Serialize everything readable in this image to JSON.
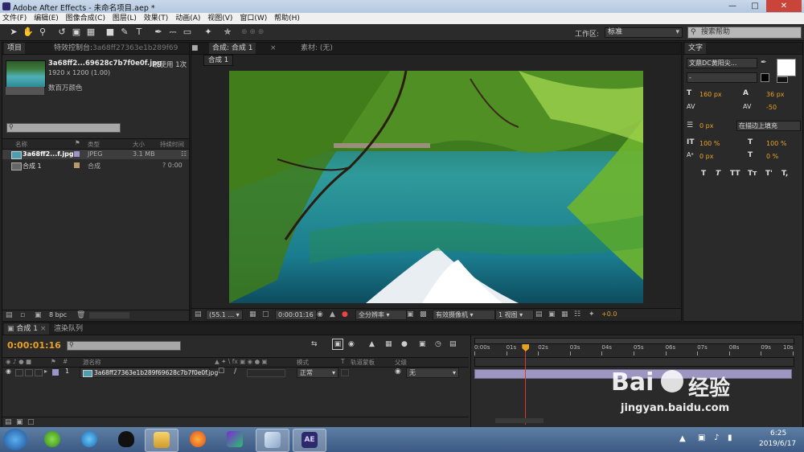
{
  "window": {
    "title": "Adobe After Effects - 未命名项目.aep *"
  },
  "menu": [
    "文件(F)",
    "编辑(E)",
    "图像合成(C)",
    "图层(L)",
    "效果(T)",
    "动画(A)",
    "视图(V)",
    "窗口(W)",
    "帮助(H)"
  ],
  "toolbar": {
    "workspace_label": "工作区:",
    "workspace_value": "标准",
    "search_placeholder": "搜索帮助"
  },
  "project": {
    "tab_project": "项目",
    "tab_effects": "特效控制台:",
    "tab_effects_file": "3a68ff27363e1b289f69",
    "file_name": "3a68ff2...69628c7b7f0e0f.jpg",
    "used_count": "被使用 1次",
    "dims": "1920 x 1200 (1.00)",
    "color_info": "数百万颜色",
    "headers": {
      "name": "名称",
      "type": "类型",
      "size": "大小",
      "duration": "持续时间"
    },
    "items": [
      {
        "name": "3a68ff2...f.jpg",
        "type": "JPEG",
        "size": "3.1 MB",
        "duration": ""
      },
      {
        "name": "合成 1",
        "type": "合成",
        "size": "",
        "duration": "? 0:00"
      }
    ],
    "bpc": "8 bpc"
  },
  "composition": {
    "tab_label": "合成: 合成 1",
    "footage_label": "素材: (无)",
    "breadcrumb": "合成 1",
    "zoom": "(55.1 ...",
    "timecode": "0:00:01:16",
    "resolution": "全分辨率",
    "camera": "有效摄像机",
    "views": "1 视图",
    "exposure": "+0.0"
  },
  "character": {
    "tab": "文字",
    "font": "文鼎DC黄阳尖...",
    "style": "-",
    "size": "160 px",
    "leading": "36 px",
    "kerning": "",
    "tracking": "-50",
    "stroke": "0 px",
    "stroke_mode": "在描边上填充",
    "vscale": "100 %",
    "hscale": "100 %",
    "baseline": "0 px",
    "tsume": "0 %",
    "buttons": [
      "T",
      "T",
      "TT",
      "Tт",
      "T'",
      "T,"
    ]
  },
  "timeline": {
    "tab_comp": "合成 1",
    "tab_render": "渲染队列",
    "timecode": "0:00:01:16",
    "headers": {
      "source": "源名称",
      "mode": "模式",
      "t": "T",
      "trkmat": "轨道蒙板",
      "parent": "父级"
    },
    "ruler": [
      "0:00s",
      "01s",
      "02s",
      "03s",
      "04s",
      "05s",
      "06s",
      "07s",
      "08s",
      "09s",
      "10s"
    ],
    "layer": {
      "index": "1",
      "name": "3a68ff27363e1b289f69628c7b7f0e0f.jpg",
      "mode": "正常",
      "parent": "无"
    },
    "playhead_fraction": 0.16
  },
  "taskbar": {
    "time": "6:25",
    "date": "2019/6/17",
    "ae_label": "AE"
  },
  "watermark": {
    "brand": "Bai",
    "brand2": "经验",
    "url": "jingyan.baidu.com"
  },
  "colors": {
    "accent": "#e8a025",
    "bg": "#232323",
    "layer_bar": "#9d96c0"
  }
}
